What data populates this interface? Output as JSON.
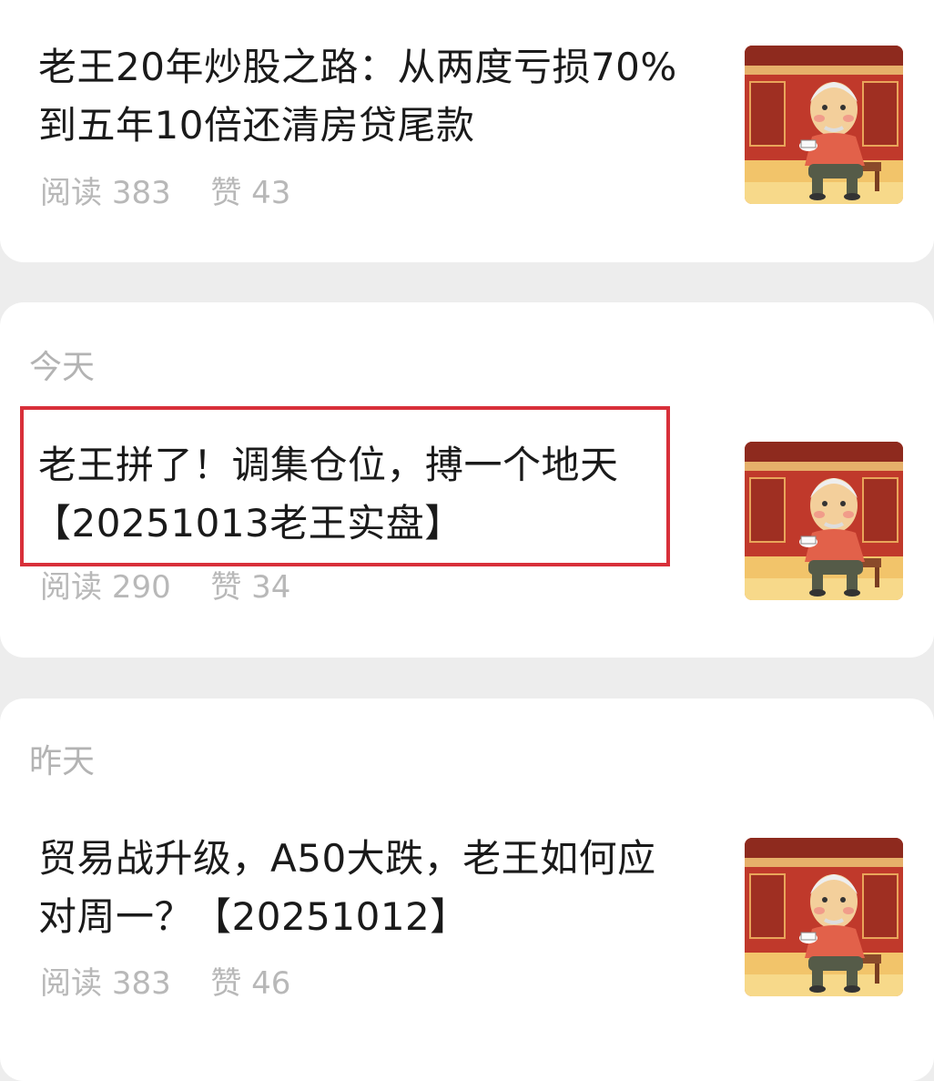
{
  "articles": [
    {
      "date_label": "",
      "title_line1": "老王20年炒股之路：从两度亏损70%",
      "title_line2": "到五年10倍还清房贷尾款",
      "read_label": "阅读",
      "read_count": "383",
      "like_label": "赞",
      "like_count": "43",
      "thumbnail": "old-man-tea-illustration"
    },
    {
      "date_label": "今天",
      "title_line1": "老王拼了！调集仓位，搏一个地天",
      "title_line2": "【20251013老王实盘】",
      "read_label": "阅读",
      "read_count": "290",
      "like_label": "赞",
      "like_count": "34",
      "thumbnail": "old-man-tea-illustration",
      "highlighted": true
    },
    {
      "date_label": "昨天",
      "title_line1": "贸易战升级，A50大跌，老王如何应",
      "title_line2": "对周一？【20251012】",
      "read_label": "阅读",
      "read_count": "383",
      "like_label": "赞",
      "like_count": "46",
      "thumbnail": "old-man-tea-illustration"
    }
  ],
  "colors": {
    "background": "#ededed",
    "card": "#ffffff",
    "title": "#1a1a1a",
    "meta": "#b8b8b8",
    "date_label": "#b3b3b3",
    "highlight_border": "#d8303a"
  }
}
